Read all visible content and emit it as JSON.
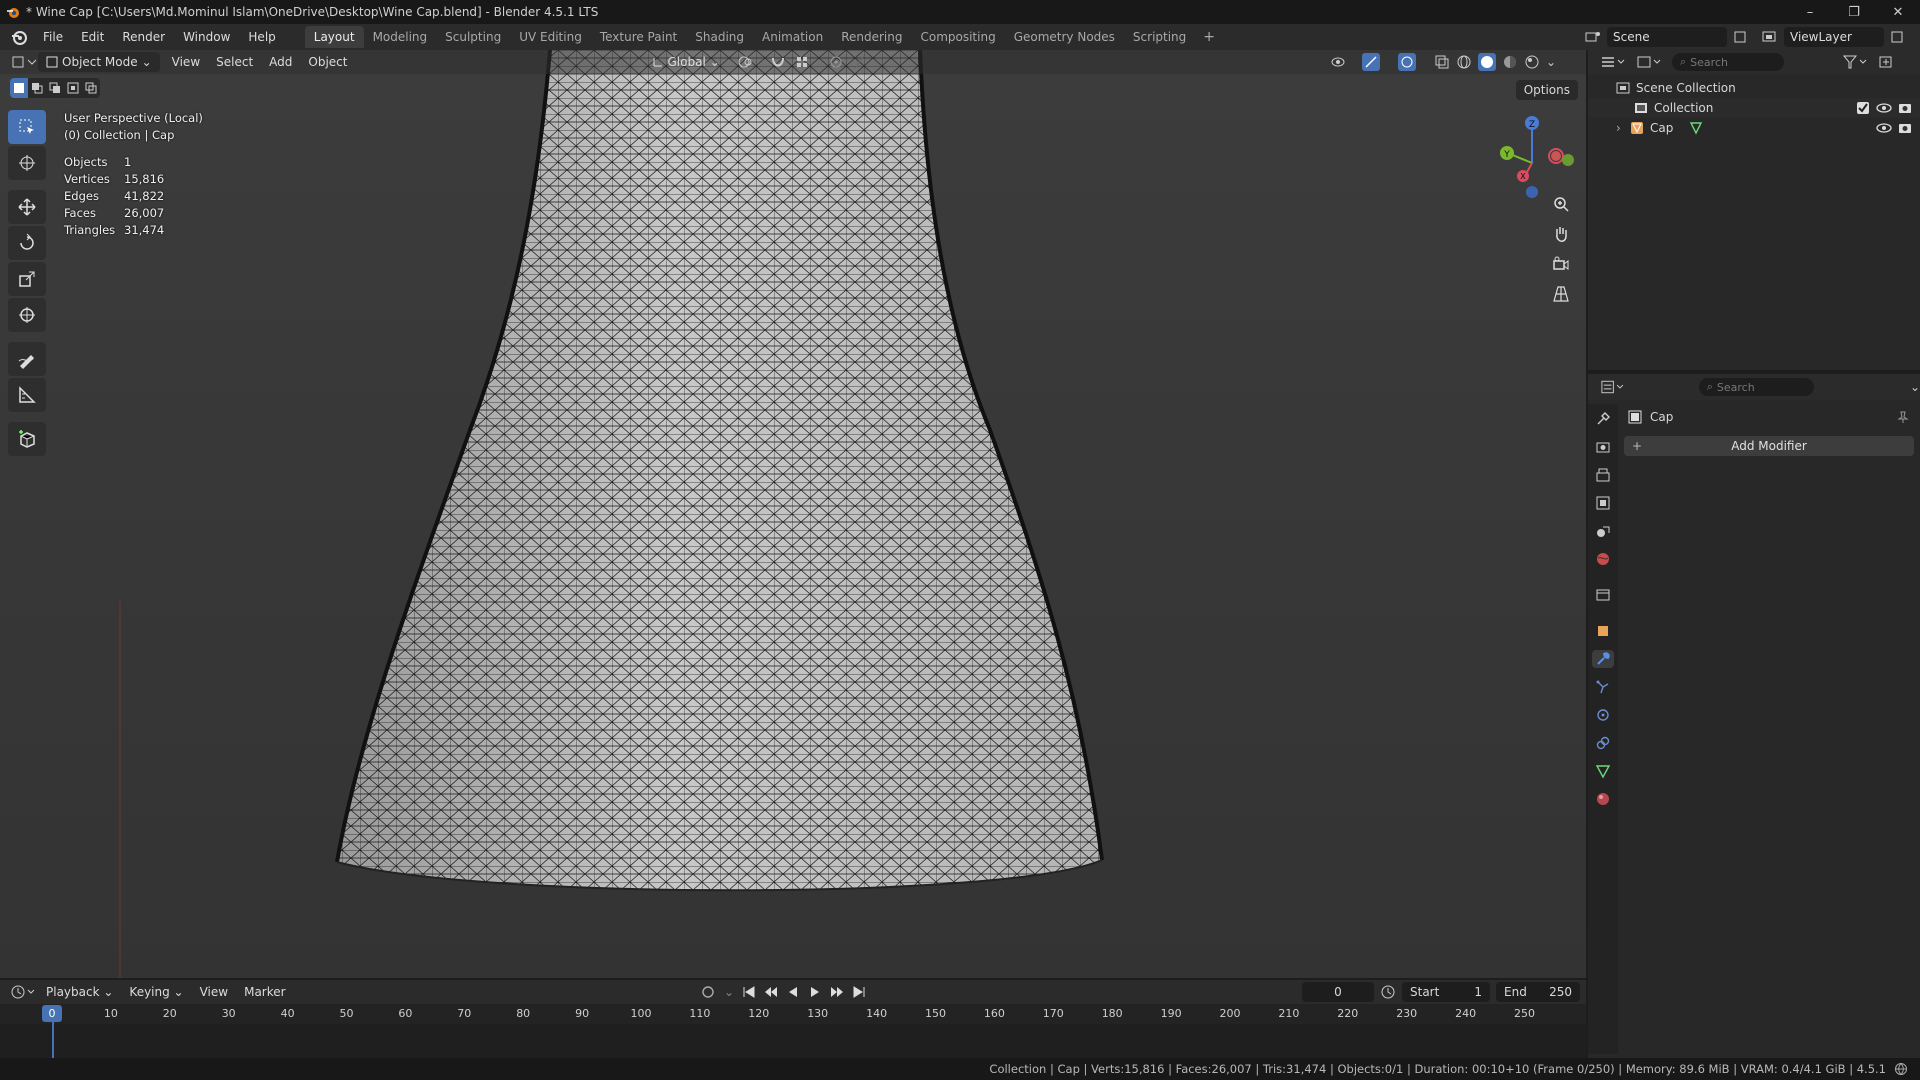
{
  "window": {
    "title": "* Wine Cap [C:\\Users\\Md.Mominul Islam\\OneDrive\\Desktop\\Wine Cap.blend] - Blender 4.5.1 LTS",
    "minimize": "–",
    "maximize": "❐",
    "close": "✕"
  },
  "menu": [
    "File",
    "Edit",
    "Render",
    "Window",
    "Help"
  ],
  "workspaces": [
    "Layout",
    "Modeling",
    "Sculpting",
    "UV Editing",
    "Texture Paint",
    "Shading",
    "Animation",
    "Rendering",
    "Compositing",
    "Geometry Nodes",
    "Scripting"
  ],
  "active_workspace": "Layout",
  "scene": "Scene",
  "view_layer": "ViewLayer",
  "viewport": {
    "mode": "Object Mode",
    "menus": [
      "View",
      "Select",
      "Add",
      "Object"
    ],
    "orientation": "Global",
    "options": "Options",
    "perspective": "User Perspective (Local)",
    "collection_info": "(0) Collection | Cap",
    "stats": [
      {
        "label": "Objects",
        "value": "1"
      },
      {
        "label": "Vertices",
        "value": "15,816"
      },
      {
        "label": "Edges",
        "value": "41,822"
      },
      {
        "label": "Faces",
        "value": "26,007"
      },
      {
        "label": "Triangles",
        "value": "31,474"
      }
    ],
    "gizmo": {
      "z": "Z",
      "y": "Y",
      "x": "X"
    }
  },
  "outliner": {
    "search_placeholder": "Search",
    "root": "Scene Collection",
    "collection": "Collection",
    "object": "Cap"
  },
  "properties": {
    "search_placeholder": "Search",
    "object_name": "Cap",
    "add_modifier": "Add Modifier"
  },
  "timeline": {
    "menus": [
      "Playback",
      "Keying",
      "View",
      "Marker"
    ],
    "current_frame": "0",
    "start_label": "Start",
    "start_value": "1",
    "end_label": "End",
    "end_value": "250",
    "ticks": [
      "0",
      "10",
      "20",
      "30",
      "40",
      "50",
      "60",
      "70",
      "80",
      "90",
      "100",
      "110",
      "120",
      "130",
      "140",
      "150",
      "160",
      "170",
      "180",
      "190",
      "200",
      "210",
      "220",
      "230",
      "240",
      "250"
    ]
  },
  "statusbar": "Collection | Cap | Verts:15,816 | Faces:26,007 | Tris:31,474 | Objects:0/1 | Duration: 00:10+10 (Frame 0/250) | Memory: 89.6 MiB | VRAM: 0.4/4.1 GiB | 4.5.1",
  "colors": {
    "accent": "#4772b3",
    "viewport_bg": "#3a3a3a",
    "panel_bg": "#282828"
  }
}
